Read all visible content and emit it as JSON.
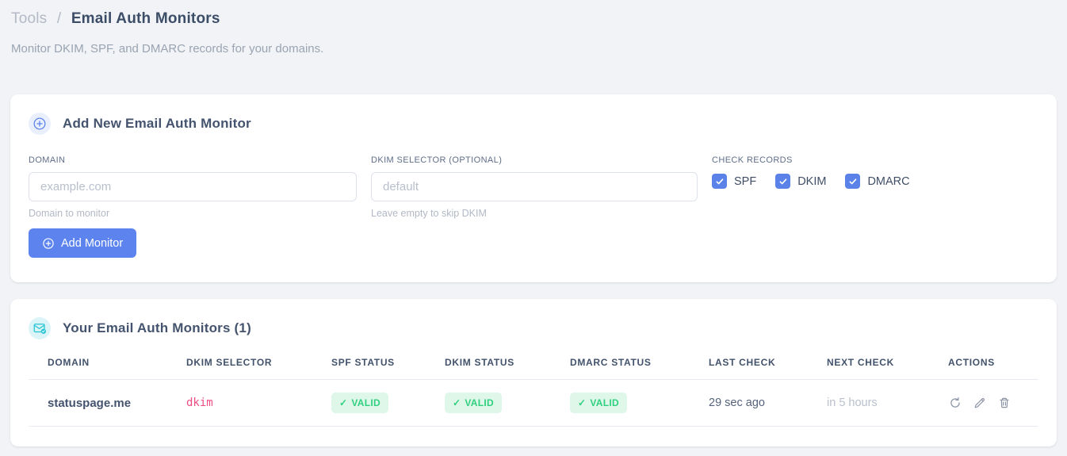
{
  "page": {
    "breadcrumb": {
      "parent": "Tools",
      "separator": "/",
      "current": "Email Auth Monitors"
    },
    "subtitle": "Monitor DKIM, SPF, and DMARC records for your domains."
  },
  "add_card": {
    "title": "Add New Email Auth Monitor",
    "fields": {
      "domain": {
        "label": "DOMAIN",
        "placeholder": "example.com",
        "value": "",
        "helper": "Domain to monitor"
      },
      "dkim_selector": {
        "label": "DKIM SELECTOR (OPTIONAL)",
        "placeholder": "default",
        "value": "",
        "helper": "Leave empty to skip DKIM"
      }
    },
    "check_records": {
      "label": "CHECK RECORDS",
      "options": [
        {
          "label": "SPF",
          "checked": true
        },
        {
          "label": "DKIM",
          "checked": true
        },
        {
          "label": "DMARC",
          "checked": true
        }
      ]
    },
    "submit_label": "Add Monitor"
  },
  "monitors_card": {
    "title": "Your Email Auth Monitors (1)",
    "badge_check": "✓",
    "table": {
      "columns": [
        "DOMAIN",
        "DKIM SELECTOR",
        "SPF STATUS",
        "DKIM STATUS",
        "DMARC STATUS",
        "LAST CHECK",
        "NEXT CHECK",
        "ACTIONS"
      ],
      "rows": [
        {
          "domain": "statuspage.me",
          "dkim_selector": "dkim",
          "spf_status": "VALID",
          "dkim_status": "VALID",
          "dmarc_status": "VALID",
          "last_check": "29 sec ago",
          "next_check": "in 5 hours",
          "actions": [
            "refresh",
            "edit",
            "delete"
          ]
        }
      ]
    }
  },
  "icons": {
    "add_header": "plus-circle",
    "monitors_header": "envelope-check",
    "checkbox": "check",
    "row_actions": [
      "refresh",
      "pencil",
      "trash"
    ]
  },
  "colors": {
    "accent_blue": "#5c83ee",
    "checkbox_blue": "#5b82e8",
    "teal": "#24c4d4",
    "valid_text": "#2fd07f",
    "valid_bg": "#def7e9",
    "code_pink": "#ed4f82",
    "page_bg": "#f1f3f6"
  }
}
